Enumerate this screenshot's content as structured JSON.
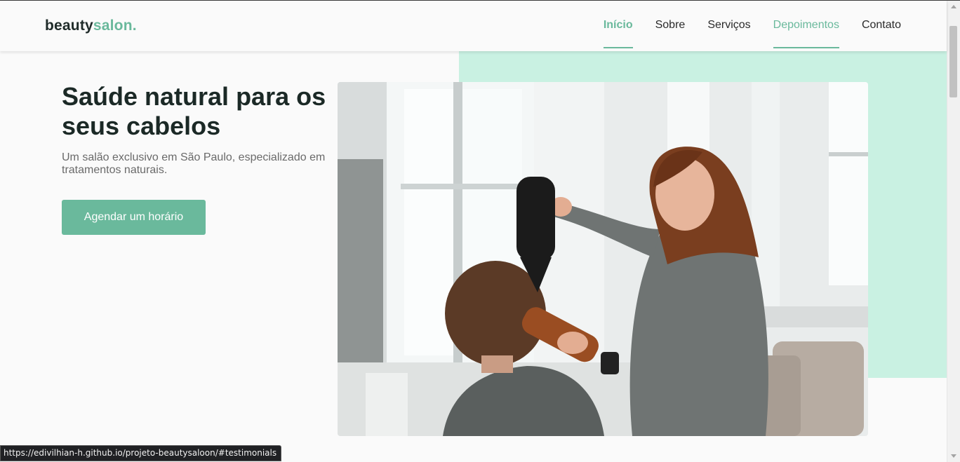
{
  "header": {
    "logo_main": "beauty",
    "logo_accent": "salon.",
    "nav": [
      {
        "label": "Início"
      },
      {
        "label": "Sobre"
      },
      {
        "label": "Serviços"
      },
      {
        "label": "Depoimentos"
      },
      {
        "label": "Contato"
      }
    ]
  },
  "hero": {
    "title": "Saúde natural para os seus cabelos",
    "subtitle": "Um salão exclusivo em São Paulo, especializado em tratamentos naturais.",
    "cta_label": "Agendar um horário"
  },
  "status_bar": {
    "url": "https://edivilhian-h.github.io/projeto-beautysaloon/#testimonials"
  },
  "colors": {
    "accent": "#6ab99c",
    "mint_background": "#c9f1e2",
    "page_background": "#fafafa",
    "heading": "#1b2926"
  }
}
